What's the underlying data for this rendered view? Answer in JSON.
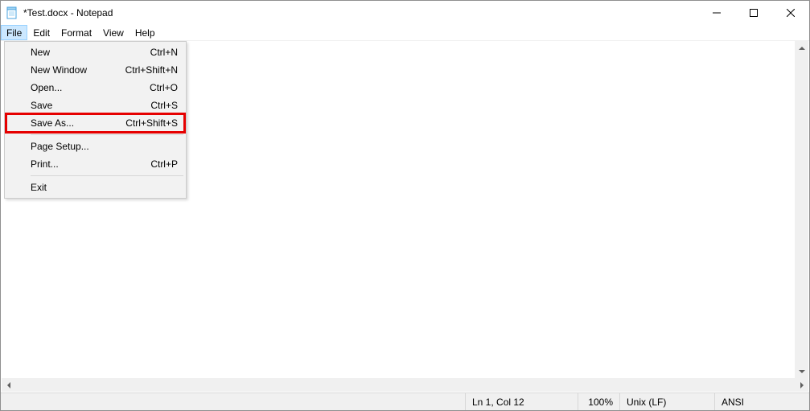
{
  "window": {
    "title": "*Test.docx - Notepad"
  },
  "menubar": {
    "items": [
      "File",
      "Edit",
      "Format",
      "View",
      "Help"
    ],
    "active": "File"
  },
  "file_menu": {
    "items": [
      {
        "label": "New",
        "shortcut": "Ctrl+N"
      },
      {
        "label": "New Window",
        "shortcut": "Ctrl+Shift+N"
      },
      {
        "label": "Open...",
        "shortcut": "Ctrl+O"
      },
      {
        "label": "Save",
        "shortcut": "Ctrl+S"
      },
      {
        "label": "Save As...",
        "shortcut": "Ctrl+Shift+S",
        "highlight": true
      },
      {
        "sep": true
      },
      {
        "label": "Page Setup...",
        "shortcut": ""
      },
      {
        "label": "Print...",
        "shortcut": "Ctrl+P"
      },
      {
        "sep": true
      },
      {
        "label": "Exit",
        "shortcut": ""
      }
    ]
  },
  "status": {
    "position": "Ln 1, Col 12",
    "zoom": "100%",
    "eol": "Unix (LF)",
    "encoding": "ANSI"
  }
}
